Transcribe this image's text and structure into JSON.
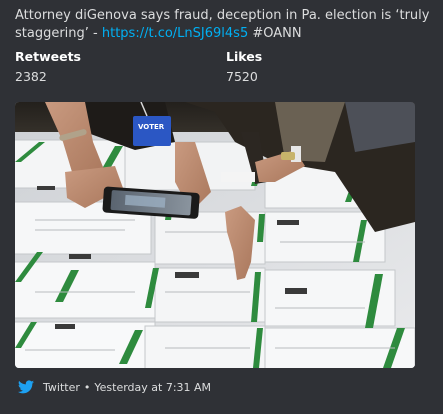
{
  "tweet": {
    "text_before": "Attorney diGenova says fraud, deception in Pa. election is ‘truly staggering’ - ",
    "link": "https://t.co/LnSJ69l4s5",
    "hashtag": " #OANN"
  },
  "fields": {
    "retweets_label": "Retweets",
    "retweets_value": "2382",
    "likes_label": "Likes",
    "likes_value": "7520"
  },
  "image": {
    "badge_text": "VOTER"
  },
  "footer": {
    "source": "Twitter",
    "separator": "•",
    "timestamp": "Yesterday at 7:31 AM"
  },
  "colors": {
    "background": "#2f3136",
    "link": "#00b0f4",
    "twitter_blue": "#1da1f2"
  }
}
